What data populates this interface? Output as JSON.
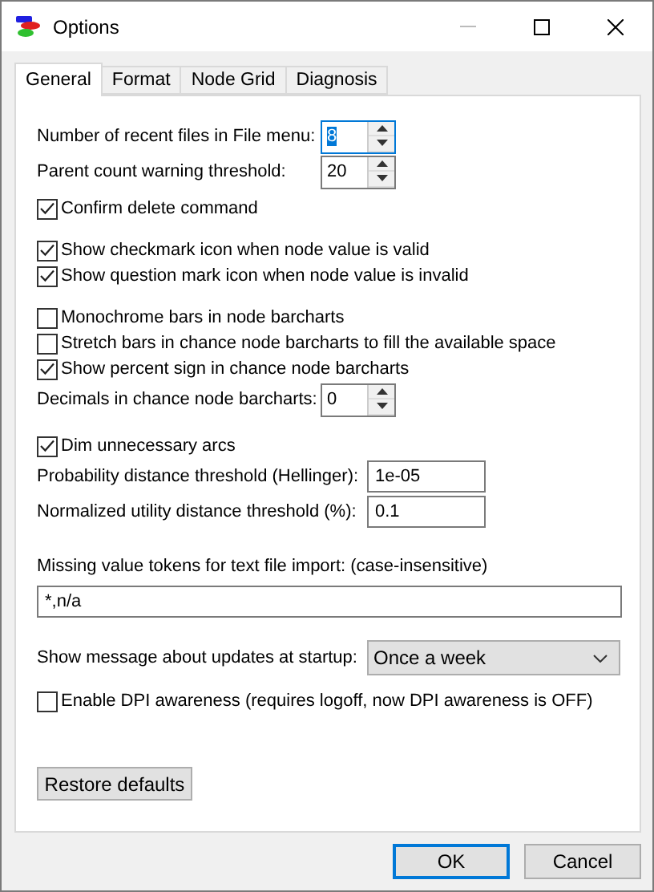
{
  "window": {
    "title": "Options"
  },
  "tabs": [
    {
      "label": "General",
      "selected": true
    },
    {
      "label": "Format",
      "selected": false
    },
    {
      "label": "Node Grid",
      "selected": false
    },
    {
      "label": "Diagnosis",
      "selected": false
    }
  ],
  "sections": [
    {
      "items": [
        {
          "kind": "spin",
          "label": "Number of recent files in File menu:",
          "value": "8",
          "focused": true
        },
        {
          "kind": "spin",
          "label": "Parent count warning threshold:",
          "value": "20",
          "focused": false
        }
      ]
    },
    {
      "items": [
        {
          "kind": "check",
          "label": "Confirm delete command",
          "checked": true
        }
      ]
    },
    {
      "items": [
        {
          "kind": "check",
          "label": "Show checkmark icon when node value is valid",
          "checked": true
        },
        {
          "kind": "check",
          "label": "Show question mark icon when node value is invalid",
          "checked": true
        }
      ]
    },
    {
      "items": [
        {
          "kind": "check",
          "label": "Monochrome bars in node barcharts",
          "checked": false
        },
        {
          "kind": "check",
          "label": "Stretch bars in chance node barcharts to fill the available space",
          "checked": false
        },
        {
          "kind": "check",
          "label": "Show percent sign in chance node barcharts",
          "checked": true
        },
        {
          "kind": "spin",
          "label": "Decimals in chance node barcharts:",
          "value": "0",
          "focused": false
        }
      ]
    },
    {
      "items": [
        {
          "kind": "check",
          "label": "Dim unnecessary arcs",
          "checked": true
        },
        {
          "kind": "field",
          "label": "Probability distance threshold (Hellinger):",
          "value": "1e-05"
        },
        {
          "kind": "field",
          "label": "Normalized utility distance threshold (%):",
          "value": "0.1"
        }
      ]
    },
    {
      "items": [
        {
          "kind": "wide",
          "label": "Missing value tokens for text file import: (case-insensitive)",
          "value": "*,n/a"
        }
      ]
    },
    {
      "items": [
        {
          "kind": "dropdown",
          "label": "Show message about updates at startup:",
          "value": "Once a week"
        }
      ]
    },
    {
      "items": [
        {
          "kind": "check",
          "label": "Enable DPI awareness (requires logoff, now DPI awareness is OFF)",
          "checked": false
        }
      ]
    }
  ],
  "restore_button": "Restore defaults",
  "buttons": [
    {
      "label": "OK",
      "default": true
    },
    {
      "label": "Cancel",
      "default": false
    }
  ]
}
